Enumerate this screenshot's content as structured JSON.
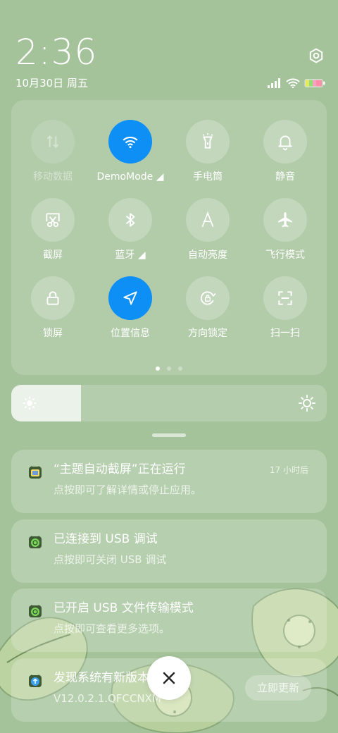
{
  "header": {
    "time": "2:36",
    "date": "10月30日 周五"
  },
  "quick_toggles": [
    {
      "label": "移动数据",
      "icon": "mobile-data-icon",
      "state": "disabled"
    },
    {
      "label": "DemoMode ◢",
      "icon": "wifi-icon",
      "state": "active"
    },
    {
      "label": "手电筒",
      "icon": "flashlight-icon",
      "state": "off"
    },
    {
      "label": "静音",
      "icon": "bell-icon",
      "state": "off"
    },
    {
      "label": "截屏",
      "icon": "screenshot-icon",
      "state": "off"
    },
    {
      "label": "蓝牙 ◢",
      "icon": "bluetooth-icon",
      "state": "off"
    },
    {
      "label": "自动亮度",
      "icon": "auto-brightness-icon",
      "state": "off"
    },
    {
      "label": "飞行模式",
      "icon": "airplane-icon",
      "state": "off"
    },
    {
      "label": "锁屏",
      "icon": "lock-icon",
      "state": "off"
    },
    {
      "label": "位置信息",
      "icon": "location-icon",
      "state": "active"
    },
    {
      "label": "方向锁定",
      "icon": "rotation-lock-icon",
      "state": "off"
    },
    {
      "label": "扫一扫",
      "icon": "scan-icon",
      "state": "off"
    }
  ],
  "pager": {
    "pages": 3,
    "current": 1
  },
  "brightness": {
    "level": 0.22
  },
  "notifications": [
    {
      "title": "“主题自动截屏”正在运行",
      "body": "点按即可了解详情或停止应用。",
      "time": "17 小时后"
    },
    {
      "title": "已连接到 USB 调试",
      "body": "点按即可关闭 USB 调试"
    },
    {
      "title": "已开启 USB 文件传输模式",
      "body": "点按即可查看更多选项。"
    },
    {
      "title": "发现系统有新版本",
      "body": "V12.0.2.1.QFCCNXM",
      "action": "立即更新"
    }
  ],
  "colors": {
    "accent": "#0d8ff5",
    "background": "#a4c39a"
  }
}
